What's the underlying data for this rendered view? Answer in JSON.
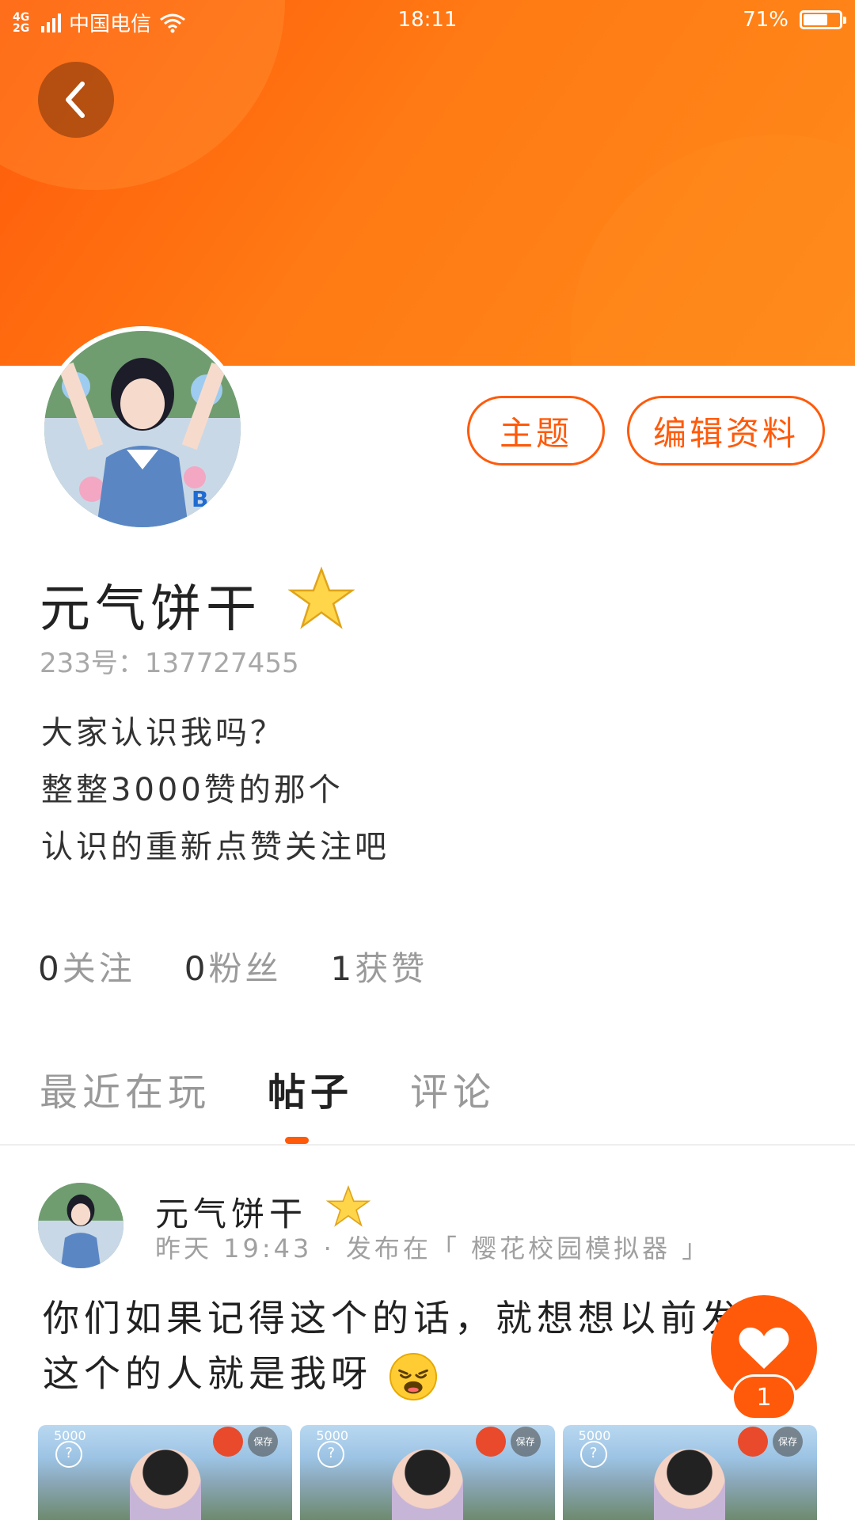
{
  "status_bar": {
    "network": "4G 2G",
    "carrier": "中国电信",
    "time": "18:11",
    "battery": "71%",
    "battery_level": 0.71
  },
  "header": {
    "back_icon": "chevron-left-icon",
    "bg_color": "#ff6a10"
  },
  "profile": {
    "avatar_alt": "avatar",
    "theme_button": "主题",
    "edit_button": "编辑资料",
    "name": "元气饼干",
    "badge_icon": "star-icon",
    "id_line": "233号：137727455",
    "bio": [
      "大家认识我吗？",
      "整整3000赞的那个",
      "认识的重新点赞关注吧"
    ],
    "stats": [
      {
        "num": "0",
        "label": "关注"
      },
      {
        "num": "0",
        "label": "粉丝"
      },
      {
        "num": "1",
        "label": "获赞"
      }
    ]
  },
  "tabs": {
    "items": [
      "最近在玩",
      "帖子",
      "评论"
    ],
    "active_index": 1
  },
  "post": {
    "author": "元气饼干",
    "meta": "昨天 19:43 · 发布在「 樱花校园模拟器 」",
    "text": "你们如果记得这个的话，就想想以前发布这个的人就是我呀",
    "emoji_icon": "weary-face-emoji-icon",
    "thumbnails": [
      {
        "score": "5000",
        "help": "?",
        "save": "保存"
      },
      {
        "score": "5000",
        "help": "?",
        "save": "保存"
      },
      {
        "score": "5000",
        "help": "?",
        "save": "保存"
      }
    ],
    "like_count": "1",
    "like_icon": "heart-icon"
  }
}
